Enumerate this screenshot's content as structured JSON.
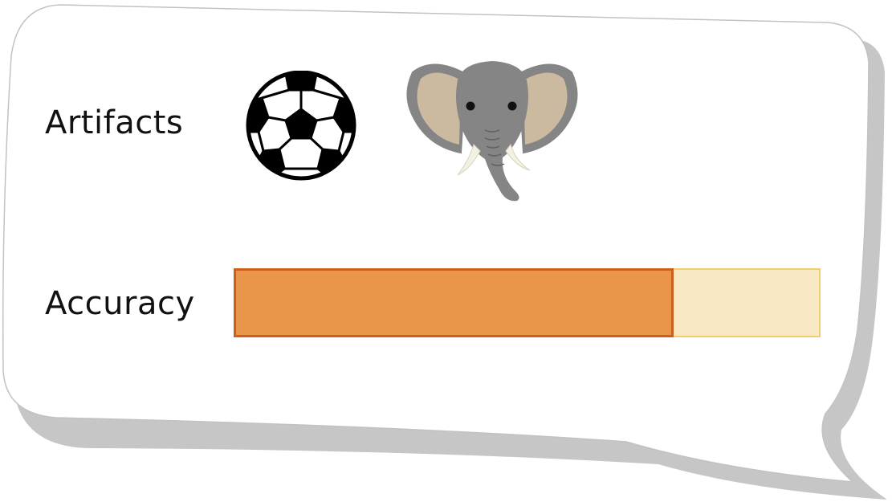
{
  "card": {
    "rows": [
      {
        "label": "Artifacts",
        "icons": [
          "soccer-ball-icon",
          "elephant-icon"
        ]
      },
      {
        "label": "Accuracy",
        "accuracy_fraction": 0.75
      }
    ]
  },
  "colors": {
    "bar_fill": "#e9954a",
    "bar_fill_border": "#cc5f1c",
    "bar_track": "#f8e9c4",
    "bar_track_border": "#f2cf6c",
    "bubble_shadow": "#c6c6c6",
    "bubble_outline": "#c2c2c2"
  }
}
